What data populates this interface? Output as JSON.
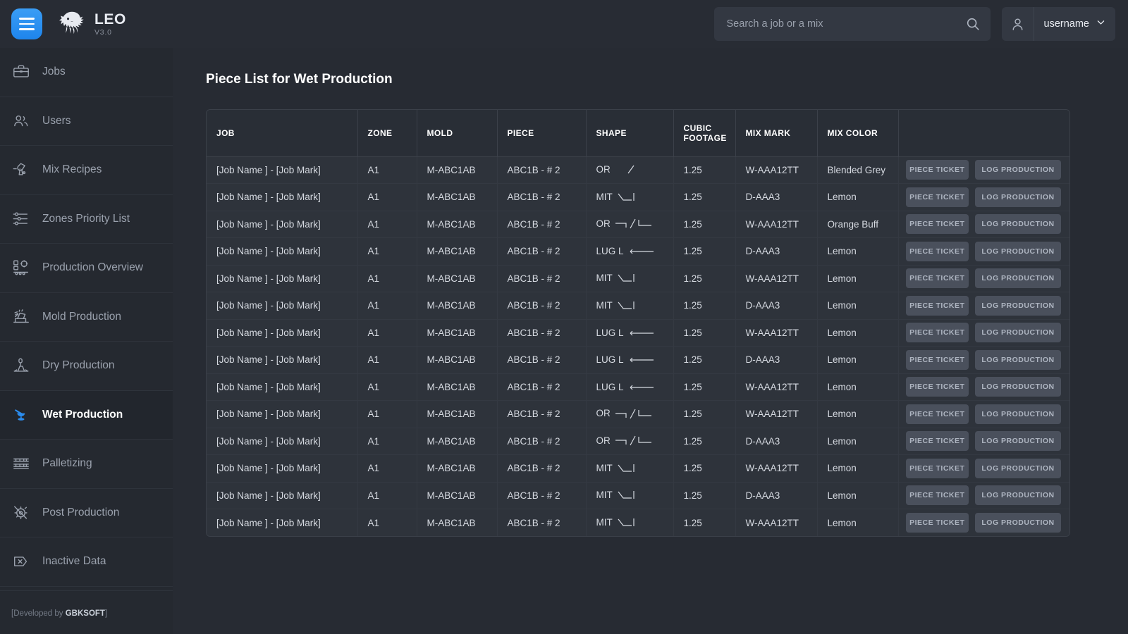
{
  "header": {
    "menu_button": "menu-toggle",
    "brand_name": "LEO",
    "brand_version": "V3.0",
    "search": {
      "value": "",
      "placeholder": "Search a job or a mix"
    },
    "user": {
      "name": "username"
    }
  },
  "sidebar": {
    "items": [
      {
        "label": "Jobs",
        "icon": "briefcase-icon",
        "active": false
      },
      {
        "label": "Users",
        "icon": "users-icon",
        "active": false
      },
      {
        "label": "Mix Recipes",
        "icon": "mixer-icon",
        "active": false
      },
      {
        "label": "Zones Priority List",
        "icon": "sliders-icon",
        "active": false
      },
      {
        "label": "Production Overview",
        "icon": "production-overview-icon",
        "active": false
      },
      {
        "label": "Mold Production",
        "icon": "mold-production-icon",
        "active": false
      },
      {
        "label": "Dry Production",
        "icon": "dry-production-icon",
        "active": false
      },
      {
        "label": "Wet Production",
        "icon": "wet-production-icon",
        "active": true
      },
      {
        "label": "Palletizing",
        "icon": "palletizing-icon",
        "active": false
      },
      {
        "label": "Post Production",
        "icon": "post-production-icon",
        "active": false
      },
      {
        "label": "Inactive Data",
        "icon": "inactive-data-icon",
        "active": false
      }
    ],
    "footer_prefix": "[Developed by ",
    "footer_brand": "GBKSOFT",
    "footer_suffix": "]"
  },
  "main": {
    "page_title": "Piece List for Wet Production",
    "table": {
      "columns": [
        "JOB",
        "ZONE",
        "MOLD",
        "PIECE",
        "SHAPE",
        "CUBIC FOOTAGE",
        "MIX MARK",
        "MIX COLOR",
        ""
      ],
      "buttons": {
        "piece_ticket": "PIECE TICKET",
        "log_production": "LOG PRODUCTION"
      },
      "rows": [
        {
          "job": "[Job Name ] - [Job Mark]",
          "zone": "A1",
          "mold": "M-ABC1AB",
          "piece": "ABC1B - # 2",
          "shape_label": "OR",
          "shape_glyph": "slash",
          "cubic_footage": "1.25",
          "mix_mark": "W-AAA12TT",
          "mix_color": "Blended Grey"
        },
        {
          "job": "[Job Name ] - [Job Mark]",
          "zone": "A1",
          "mold": "M-ABC1AB",
          "piece": "ABC1B - # 2",
          "shape_label": "MIT",
          "shape_glyph": "mitre",
          "cubic_footage": "1.25",
          "mix_mark": "D-AAA3",
          "mix_color": "Lemon"
        },
        {
          "job": "[Job Name ] - [Job Mark]",
          "zone": "A1",
          "mold": "M-ABC1AB",
          "piece": "ABC1B - # 2",
          "shape_label": "OR",
          "shape_glyph": "ortho",
          "cubic_footage": "1.25",
          "mix_mark": "W-AAA12TT",
          "mix_color": "Orange Buff"
        },
        {
          "job": "[Job Name ] - [Job Mark]",
          "zone": "A1",
          "mold": "M-ABC1AB",
          "piece": "ABC1B - # 2",
          "shape_label": "LUG L",
          "shape_glyph": "lug",
          "cubic_footage": "1.25",
          "mix_mark": "D-AAA3",
          "mix_color": "Lemon"
        },
        {
          "job": "[Job Name ] - [Job Mark]",
          "zone": "A1",
          "mold": "M-ABC1AB",
          "piece": "ABC1B - # 2",
          "shape_label": "MIT",
          "shape_glyph": "mitre",
          "cubic_footage": "1.25",
          "mix_mark": "W-AAA12TT",
          "mix_color": "Lemon"
        },
        {
          "job": "[Job Name ] - [Job Mark]",
          "zone": "A1",
          "mold": "M-ABC1AB",
          "piece": "ABC1B - # 2",
          "shape_label": "MIT",
          "shape_glyph": "mitre",
          "cubic_footage": "1.25",
          "mix_mark": "D-AAA3",
          "mix_color": "Lemon"
        },
        {
          "job": "[Job Name ] - [Job Mark]",
          "zone": "A1",
          "mold": "M-ABC1AB",
          "piece": "ABC1B - # 2",
          "shape_label": "LUG L",
          "shape_glyph": "lug",
          "cubic_footage": "1.25",
          "mix_mark": "W-AAA12TT",
          "mix_color": "Lemon"
        },
        {
          "job": "[Job Name ] - [Job Mark]",
          "zone": "A1",
          "mold": "M-ABC1AB",
          "piece": "ABC1B - # 2",
          "shape_label": "LUG L",
          "shape_glyph": "lug",
          "cubic_footage": "1.25",
          "mix_mark": "D-AAA3",
          "mix_color": "Lemon"
        },
        {
          "job": "[Job Name ] - [Job Mark]",
          "zone": "A1",
          "mold": "M-ABC1AB",
          "piece": "ABC1B - # 2",
          "shape_label": "LUG L",
          "shape_glyph": "lug",
          "cubic_footage": "1.25",
          "mix_mark": "W-AAA12TT",
          "mix_color": "Lemon"
        },
        {
          "job": "[Job Name ] - [Job Mark]",
          "zone": "A1",
          "mold": "M-ABC1AB",
          "piece": "ABC1B - # 2",
          "shape_label": "OR",
          "shape_glyph": "ortho",
          "cubic_footage": "1.25",
          "mix_mark": "W-AAA12TT",
          "mix_color": "Lemon"
        },
        {
          "job": "[Job Name ] - [Job Mark]",
          "zone": "A1",
          "mold": "M-ABC1AB",
          "piece": "ABC1B - # 2",
          "shape_label": "OR",
          "shape_glyph": "ortho",
          "cubic_footage": "1.25",
          "mix_mark": "D-AAA3",
          "mix_color": "Lemon"
        },
        {
          "job": "[Job Name ] - [Job Mark]",
          "zone": "A1",
          "mold": "M-ABC1AB",
          "piece": "ABC1B - # 2",
          "shape_label": "MIT",
          "shape_glyph": "mitre",
          "cubic_footage": "1.25",
          "mix_mark": "W-AAA12TT",
          "mix_color": "Lemon"
        },
        {
          "job": "[Job Name ] - [Job Mark]",
          "zone": "A1",
          "mold": "M-ABC1AB",
          "piece": "ABC1B - # 2",
          "shape_label": "MIT",
          "shape_glyph": "mitre",
          "cubic_footage": "1.25",
          "mix_mark": "D-AAA3",
          "mix_color": "Lemon"
        },
        {
          "job": "[Job Name ] - [Job Mark]",
          "zone": "A1",
          "mold": "M-ABC1AB",
          "piece": "ABC1B - # 2",
          "shape_label": "MIT",
          "shape_glyph": "mitre",
          "cubic_footage": "1.25",
          "mix_mark": "W-AAA12TT",
          "mix_color": "Lemon"
        }
      ]
    }
  },
  "colors": {
    "accent": "#2b8df0",
    "topbar_bg": "#282c34",
    "sidebar_bg": "#252930",
    "main_bg": "#272b33",
    "row_bg": "#2e333b",
    "border": "#3b4049",
    "button_bg": "#4a505c"
  }
}
